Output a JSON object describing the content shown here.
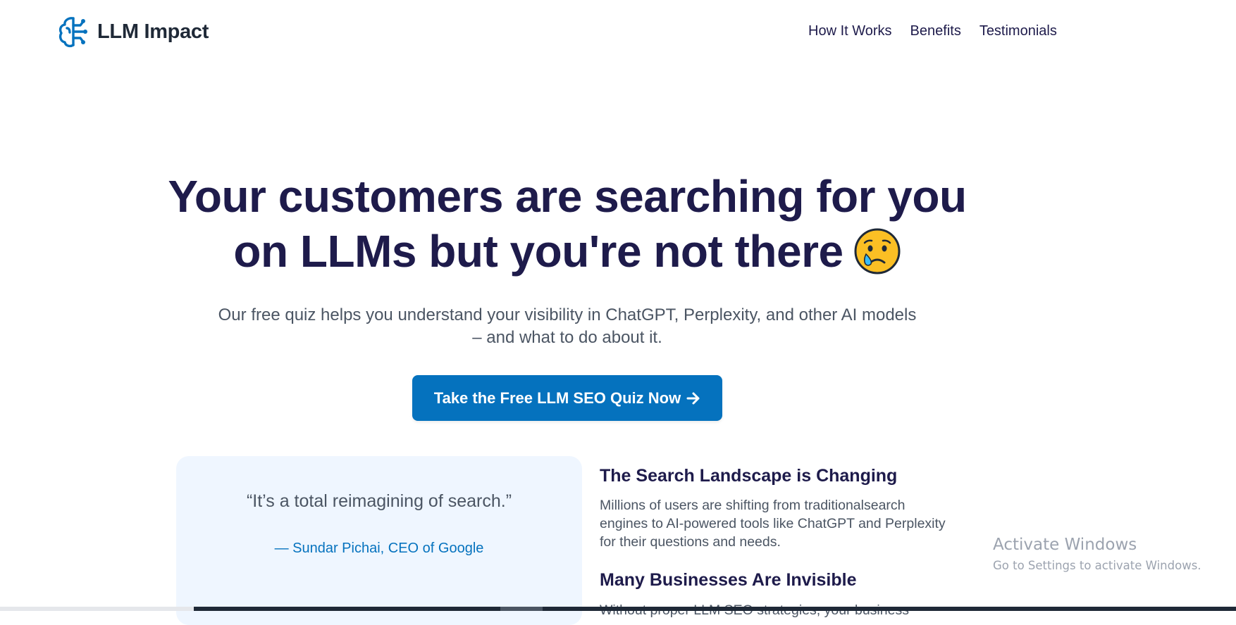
{
  "header": {
    "brand": "LLM Impact",
    "nav": [
      {
        "label": "How It Works"
      },
      {
        "label": "Benefits"
      },
      {
        "label": "Testimonials"
      }
    ]
  },
  "hero": {
    "title_line1": "Your customers are searching for you",
    "title_line2": "on LLMs but you're not there",
    "emoji": "crying-face-icon",
    "subtitle": "Our free quiz helps you understand your visibility in ChatGPT, Perplexity, and other AI models – and what to do about it.",
    "cta_label": "Take the Free LLM SEO Quiz Now"
  },
  "quote": {
    "text": "“It’s a total reimagining of search.”",
    "author": "— Sundar Pichai, CEO of Google"
  },
  "sections": [
    {
      "heading": "The Search Landscape is Changing",
      "body": "Millions of users are shifting from traditionalsearch engines to AI-powered tools like ChatGPT and Perplexity for their questions and needs."
    },
    {
      "heading": "Many Businesses Are Invisible",
      "body": "Without proper LLM SEO strategies, your business"
    }
  ],
  "watermark": {
    "title": "Activate Windows",
    "subtitle": "Go to Settings to activate Windows."
  },
  "colors": {
    "accent": "#0572be",
    "heading": "#1e1b4b",
    "body_text": "#4b5563",
    "card_bg": "#eff6ff"
  }
}
